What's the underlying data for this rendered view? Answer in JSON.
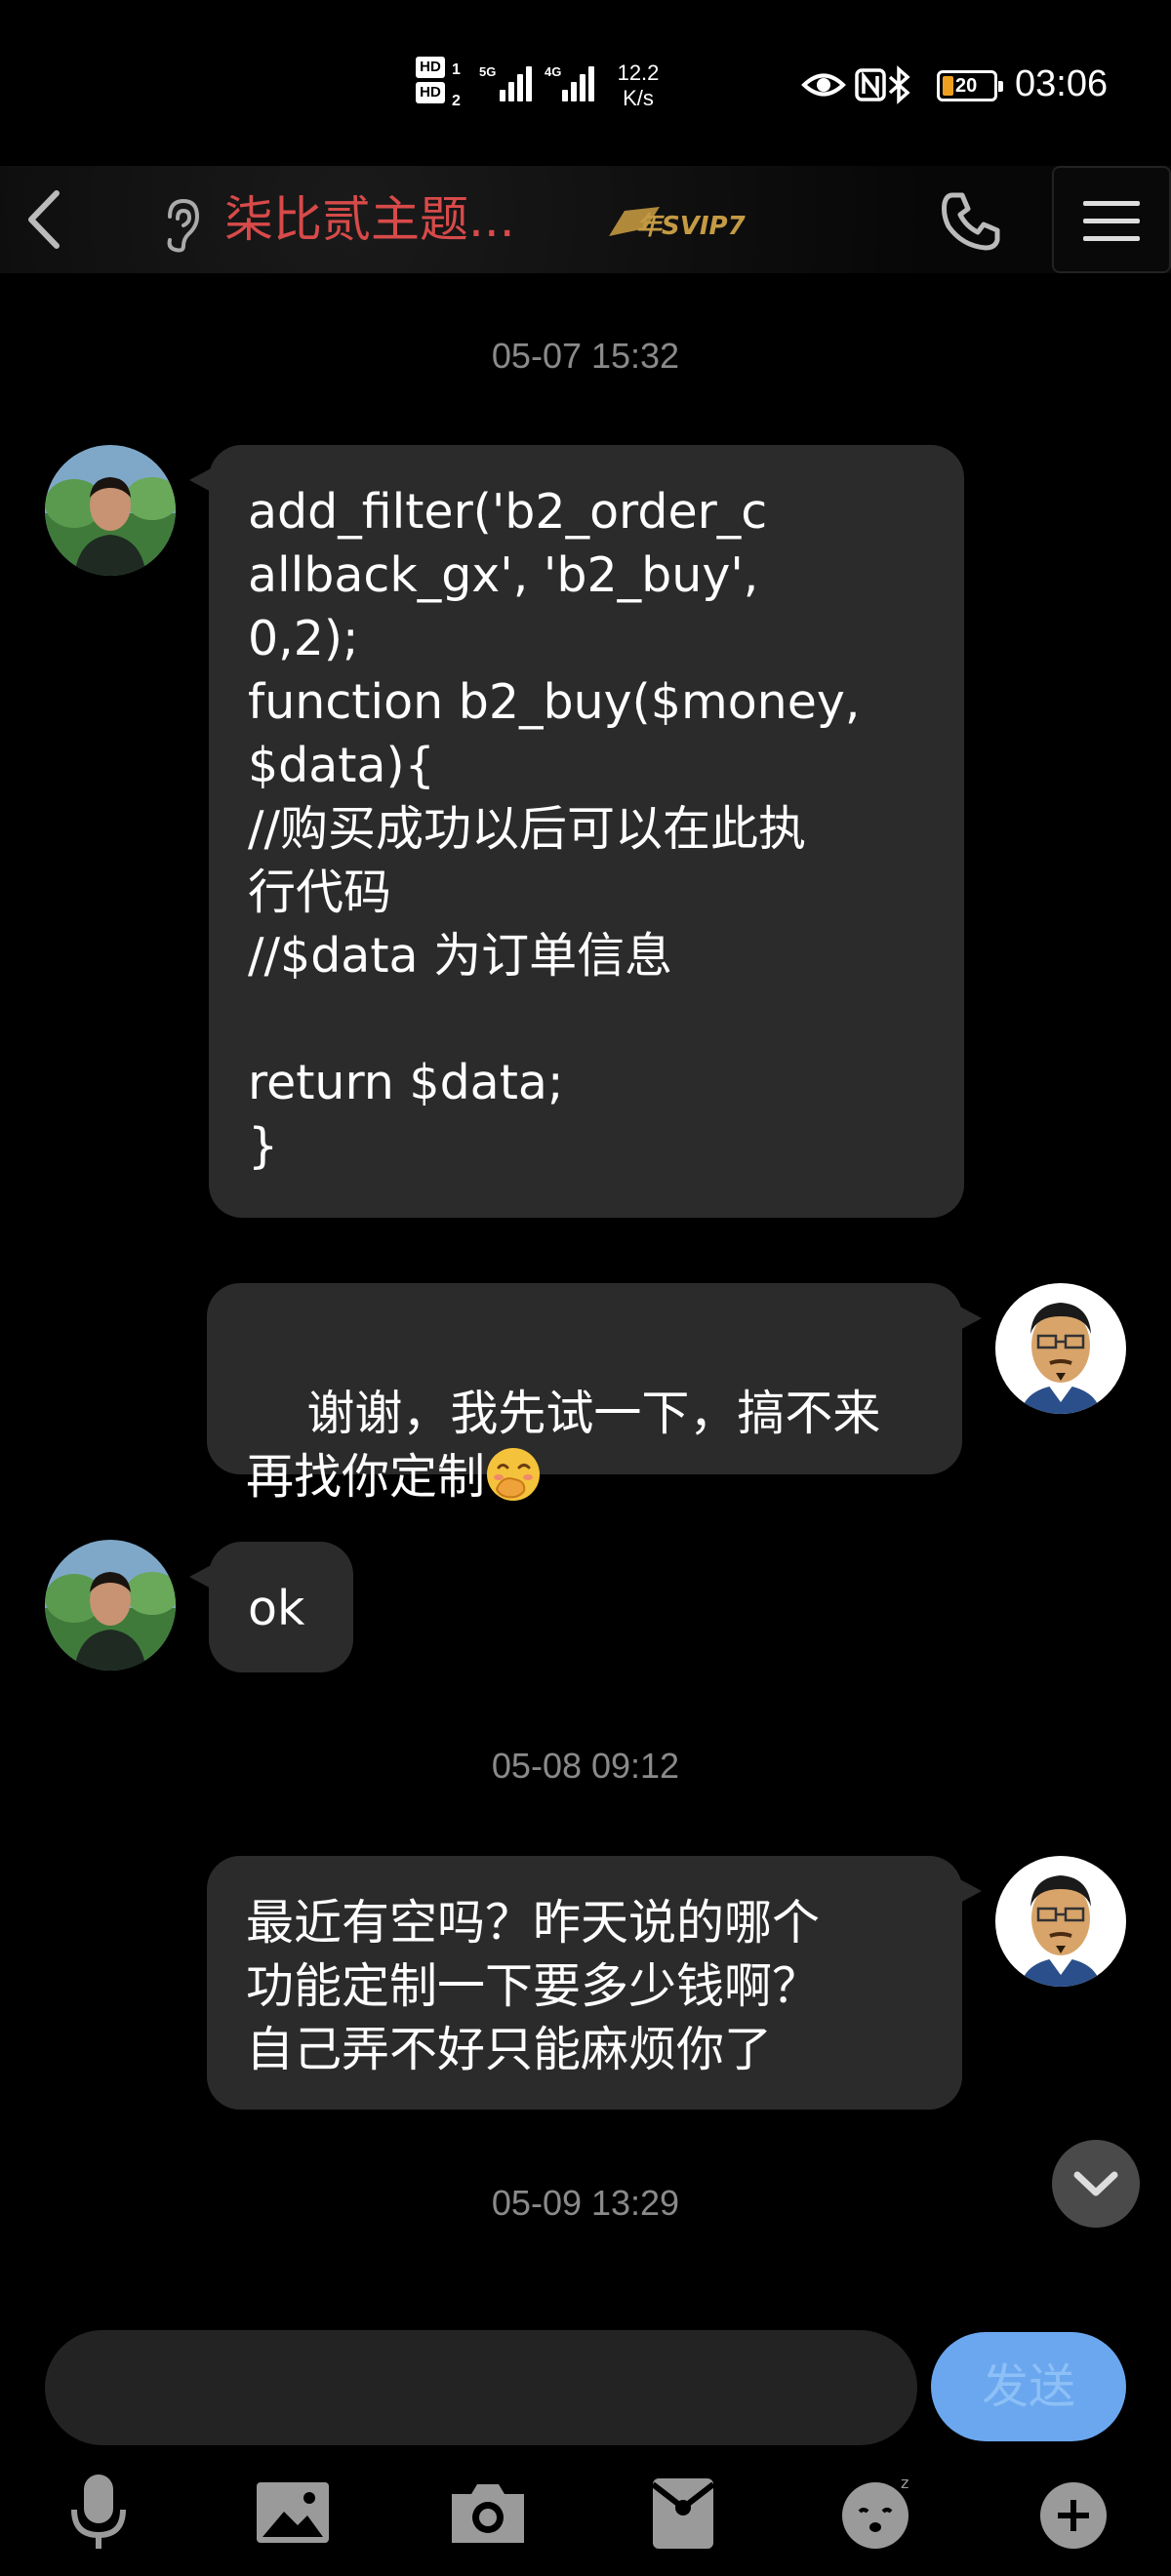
{
  "status_bar": {
    "hd1": "HD",
    "hd1_num": "1",
    "hd2": "HD",
    "hd2_num": "2",
    "net1": "5G",
    "net2": "4G",
    "speed_value": "12.2",
    "speed_unit": "K/s",
    "battery": "20",
    "time": "03:06"
  },
  "header": {
    "title": "柒比贰主题...",
    "badge": "年SVIP7"
  },
  "messages": [
    {
      "type": "time",
      "text": "05-07 15:32"
    },
    {
      "type": "incoming",
      "text": "add_filter('b2_order_c\nallback_gx', 'b2_buy',\n0,2);\nfunction b2_buy($money,\n$data){\n//购买成功以后可以在此执\n行代码\n//$data 为订单信息\n\nreturn $data;\n}"
    },
    {
      "type": "outgoing",
      "text": "谢谢，我先试一下，搞不来\n再找你定制",
      "emoji": "face-with-hand-over-mouth"
    },
    {
      "type": "incoming",
      "text": "ok"
    },
    {
      "type": "time",
      "text": "05-08 09:12"
    },
    {
      "type": "outgoing",
      "text": "最近有空吗？昨天说的哪个\n功能定制一下要多少钱啊？\n自己弄不好只能麻烦你了"
    },
    {
      "type": "time",
      "text": "05-09 13:29"
    }
  ],
  "composer": {
    "placeholder": "",
    "send_label": "发送"
  },
  "toolbar": {
    "icons": [
      "microphone-icon",
      "image-icon",
      "camera-icon",
      "red-packet-icon",
      "emoji-icon",
      "plus-icon"
    ]
  },
  "colors": {
    "background": "#000000",
    "bubble": "#2b2b2b",
    "title": "#d84a4a",
    "send": "#6ba7ef",
    "timestamp": "#8a8a8a"
  }
}
